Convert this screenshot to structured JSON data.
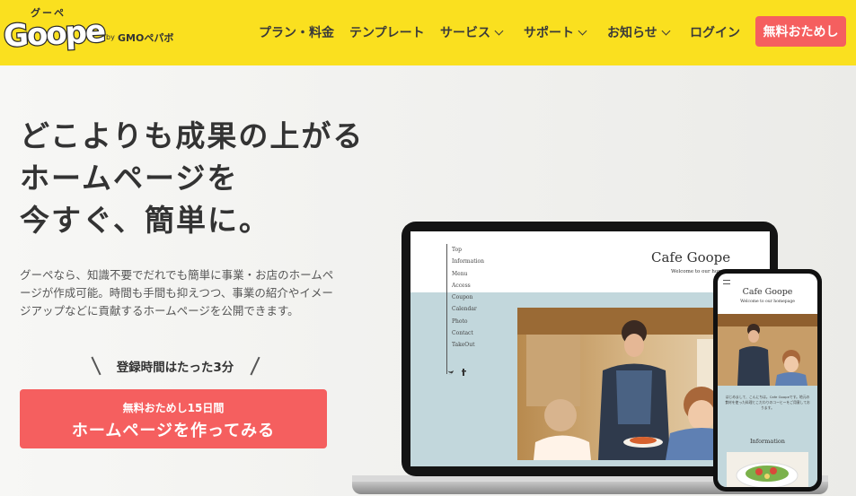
{
  "header": {
    "logo_kana": "グーペ",
    "logo_word": "Goope",
    "logo_by": "by",
    "logo_company": "GMOペパボ",
    "nav": [
      {
        "label": "プラン・料金",
        "has_dropdown": false
      },
      {
        "label": "テンプレート",
        "has_dropdown": false
      },
      {
        "label": "サービス",
        "has_dropdown": true
      },
      {
        "label": "サポート",
        "has_dropdown": true
      },
      {
        "label": "お知らせ",
        "has_dropdown": true
      },
      {
        "label": "ログイン",
        "has_dropdown": false
      }
    ],
    "cta": "無料おためし"
  },
  "hero": {
    "headline": [
      "どこよりも成果の上がる",
      "ホームページを",
      "今すぐ、簡単に。"
    ],
    "lead": "グーペなら、知識不要でだれでも簡単に事業・お店のホームページが作成可能。時間も手間も抑えつつ、事業の紹介やイメージアップなどに貢献するホームページを公開できます。",
    "note": "登録時間はたった3分",
    "cta_sub": "無料おためし15日間",
    "cta_label": "ホームページを作ってみる"
  },
  "mockup": {
    "site_title": "Cafe Goope",
    "site_welcome": "Welcome to our homepage",
    "menu": [
      "Top",
      "Information",
      "Menu",
      "Access",
      "Coupon",
      "Calendar",
      "Photo",
      "Contact",
      "TakeOut"
    ],
    "social": [
      "twitter-icon",
      "facebook-icon"
    ],
    "phone_title": "Cafe Goope",
    "phone_welcome": "Welcome to our homepage",
    "phone_text": "はじめまして、こんにちは。Cafe Goopeです。地元の食材を使った料理とこだわりのコーヒーをご用意しております。",
    "phone_info": "Information"
  },
  "colors": {
    "header_bg": "#fae01f",
    "accent": "#f55f5f",
    "mock_blue": "#c2d7dc"
  }
}
